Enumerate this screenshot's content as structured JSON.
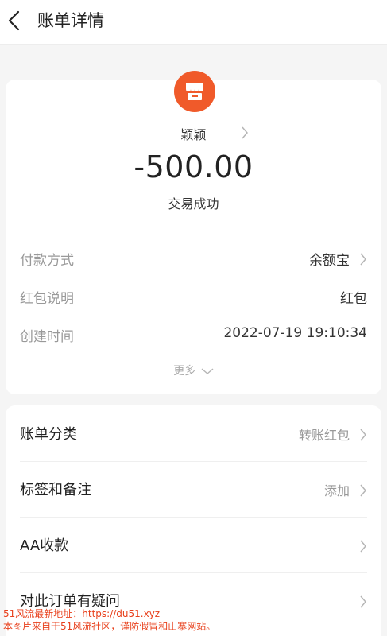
{
  "header": {
    "title": "账单详情",
    "back_icon": "chevron-left-icon"
  },
  "merchant": {
    "name": "颖颖",
    "icon": "shop-icon",
    "icon_color": "#f05a2a"
  },
  "transaction": {
    "amount": "-500.00",
    "status": "交易成功"
  },
  "details": [
    {
      "label": "付款方式",
      "value": "余额宝"
    },
    {
      "label": "红包说明",
      "value": "红包"
    },
    {
      "label": "创建时间",
      "value": "2022-07-19 19:10:34"
    }
  ],
  "more_label": "更多",
  "actions": [
    {
      "label": "账单分类",
      "value": "转账红包"
    },
    {
      "label": "标签和备注",
      "value": "添加"
    },
    {
      "label": "AA收款",
      "value": ""
    },
    {
      "label": "对此订单有疑问",
      "value": ""
    }
  ],
  "watermark": {
    "line1": "51风流最新地址：https://du51.xyz",
    "line2": "本图片来自于51风流社区，谨防假冒和山寨网站。"
  }
}
